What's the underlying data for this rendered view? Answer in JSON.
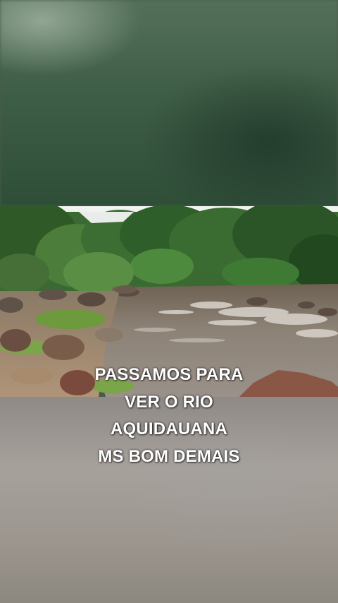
{
  "caption": {
    "lines": [
      "PASSAMOS PARA",
      "VER O RIO",
      "AQUIDAUANA",
      "MS BOM DEMAIS"
    ]
  },
  "scene": {
    "subject": "river-with-rapids",
    "colors": {
      "forest": "#2f5a2a",
      "water": "#8a7f74",
      "rocks": "#7a5a48",
      "sky": "#e8ece8"
    }
  }
}
